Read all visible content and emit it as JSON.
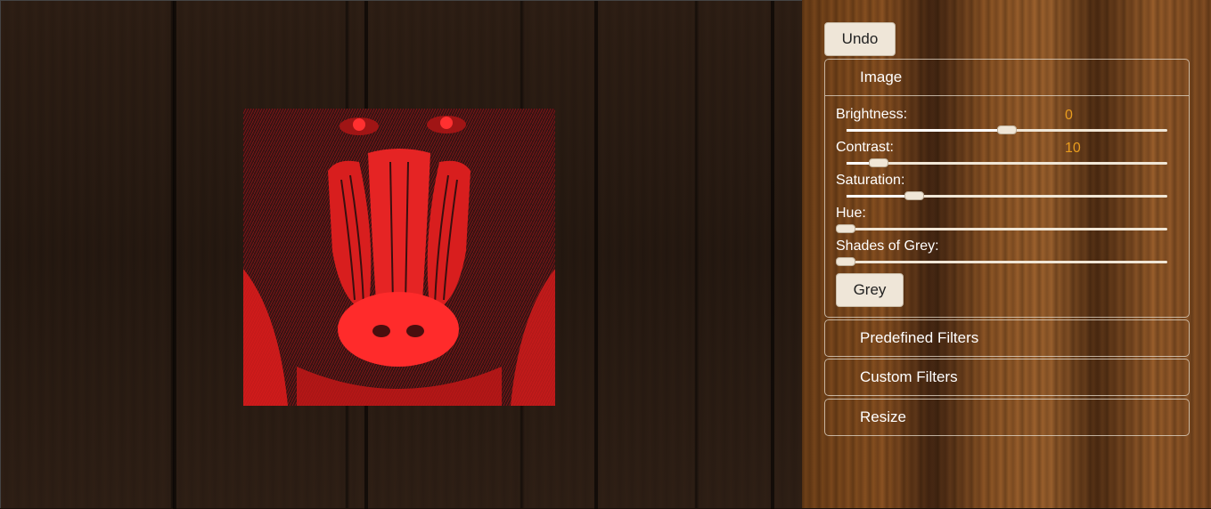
{
  "toolbar": {
    "undo_label": "Undo"
  },
  "panels": [
    {
      "title": "Image",
      "controls": [
        {
          "label": "Brightness:",
          "value": "0",
          "level": 0.5
        },
        {
          "label": "Contrast:",
          "value": "10",
          "level": 0.1
        },
        {
          "label": "Saturation:",
          "value": "",
          "level": 0.21
        },
        {
          "label": "Hue:",
          "value": "",
          "level": 0.0
        },
        {
          "label": "Shades of Grey:",
          "value": "",
          "level": 0.0
        }
      ],
      "grey_button": "Grey"
    },
    {
      "title": "Predefined Filters"
    },
    {
      "title": "Custom Filters"
    },
    {
      "title": "Resize"
    }
  ],
  "colors": {
    "value_text": "#e89c1e",
    "image_tint": "#e31b1b"
  }
}
